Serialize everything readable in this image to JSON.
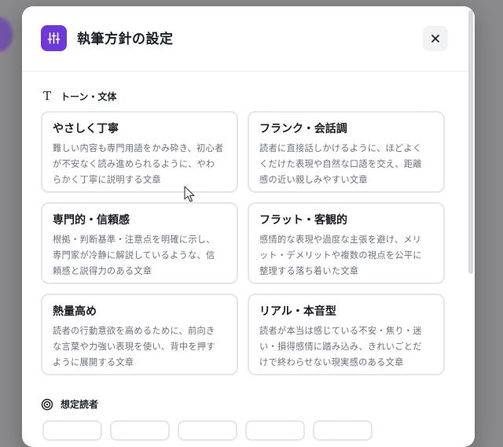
{
  "modal": {
    "title": "執筆方針の設定",
    "header_icon": "sliders-icon",
    "close_icon": "close-icon"
  },
  "colors": {
    "accent": "#6d39d6",
    "card_border": "#e3e6ea",
    "text_primary": "#1a1d24",
    "text_secondary": "#6a717c"
  },
  "tone_section": {
    "icon": "text-type-icon",
    "label": "トーン・文体",
    "options": [
      {
        "title": "やさしく丁寧",
        "desc": [
          "難しい内容も専門用語をかみ砕き、初心者",
          "が不安なく読み進められるように、やわ",
          "らかく丁寧に説明する文章"
        ]
      },
      {
        "title": "フランク・会話調",
        "desc": [
          "読者に直接話しかけるように、ほどよく",
          "くだけた表現や自然な口語を交え、距離",
          "感の近い親しみやすい文章"
        ]
      },
      {
        "title": "専門的・信頼感",
        "desc": [
          "根拠・判断基準・注意点を明確に示し、",
          "専門家が冷静に解説しているような、信",
          "頼感と説得力のある文章"
        ]
      },
      {
        "title": "フラット・客観的",
        "desc": [
          "感情的な表現や過度な主張を避け、メリ",
          "ット・デメリットや複数の視点を公平に",
          "整理する落ち着いた文章"
        ]
      },
      {
        "title": "熱量高め",
        "desc": [
          "読者の行動意欲を高めるために、前向き",
          "な言葉や力強い表現を使い、背中を押す",
          "ように展開する文章"
        ]
      },
      {
        "title": "リアル・本音型",
        "desc": [
          "読者が本当は感じている不安・焦り・迷",
          "い・損得感情に踏み込み、きれいごとだ",
          "けで終わらせない現実感のある文章"
        ]
      }
    ]
  },
  "audience_section": {
    "icon": "target-icon",
    "label": "想定読者"
  }
}
